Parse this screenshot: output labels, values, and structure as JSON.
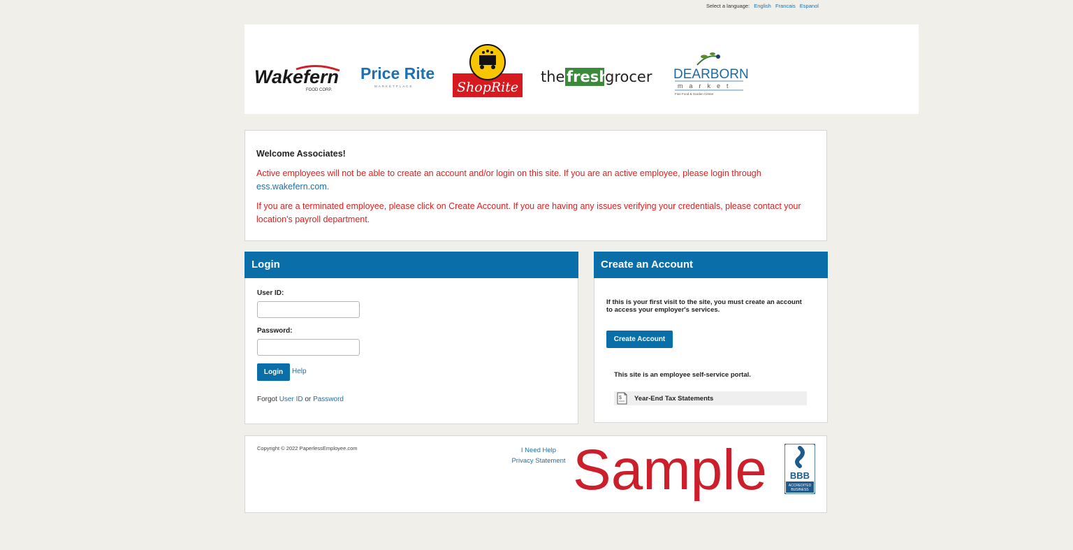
{
  "language_bar": {
    "prompt": "Select a language:",
    "options": [
      "English",
      "Francais",
      "Espanol"
    ]
  },
  "logos": {
    "wakefern": {
      "name": "Wakefern",
      "sub": "FOOD CORP."
    },
    "price_rite": {
      "name": "Price Rite",
      "sub": "MARKETPLACE"
    },
    "shoprite": {
      "name": "ShopRite"
    },
    "fresh_grocer": {
      "pre": "the",
      "mid": "fresh",
      "post": "grocer"
    },
    "dearborn": {
      "name": "DEARBORN",
      "sub": "market",
      "tag": "Fine Food & Garden Center"
    }
  },
  "welcome": {
    "title": "Welcome Associates!",
    "para1_text": "Active employees will not be able to create an account and/or login on this site.  If you are an active employee, please login through",
    "para1_link": "ess.wakefern.com",
    "para1_end": ".",
    "para2": "If you are a terminated employee, please click on Create Account. If you are having any issues verifying your credentials, please contact your location's payroll department."
  },
  "login": {
    "title": "Login",
    "user_id_label": "User ID:",
    "user_id_value": "",
    "password_label": "Password:",
    "password_value": "",
    "login_button": "Login",
    "help_link": "Help",
    "forgot_prefix": "Forgot",
    "forgot_user_id": "User ID",
    "forgot_or": "or",
    "forgot_password": "Password"
  },
  "create_account": {
    "title": "Create an Account",
    "description": "If this is your first visit to the site, you must create an account to access your employer's services.",
    "button": "Create Account",
    "portal_note": "This site is an employee self-service portal.",
    "services": [
      "Year-End Tax Statements"
    ]
  },
  "footer": {
    "copyright": "Copyright © 2022 PaperlessEmployee.com",
    "help_link": "I Need Help",
    "privacy_link": "Privacy Statement",
    "watermark": "Sample",
    "bbb_text": "BBB",
    "bbb_sub1": "ACCREDITED",
    "bbb_sub2": "BUSINESS"
  },
  "colors": {
    "header_blue": "#0a6fa8",
    "warning_red": "#e01e1e",
    "watermark_red": "#cc1e2b",
    "background": "#f1efea"
  }
}
